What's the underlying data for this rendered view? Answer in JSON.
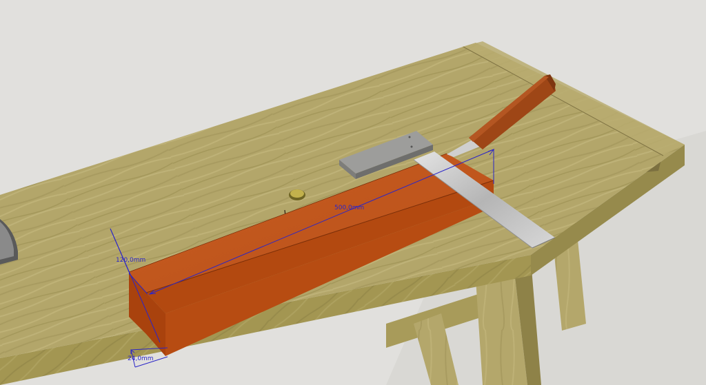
{
  "scene": {
    "dimensions": {
      "length": "500,0mm",
      "width": "120,0mm",
      "thickness": "24,0mm"
    },
    "colors": {
      "background": "#e1e0dd",
      "floor": "#d9d8d4",
      "bench_top": "#b3a66a",
      "bench_front": "#9d904f",
      "board_top": "#c45a1e",
      "board_front": "#b34910",
      "square_stock": "#8f8f8d",
      "square_blade": "#c9c9c9",
      "chisel_handle": "#9e4616",
      "dimension_line": "#2a25c8"
    }
  }
}
